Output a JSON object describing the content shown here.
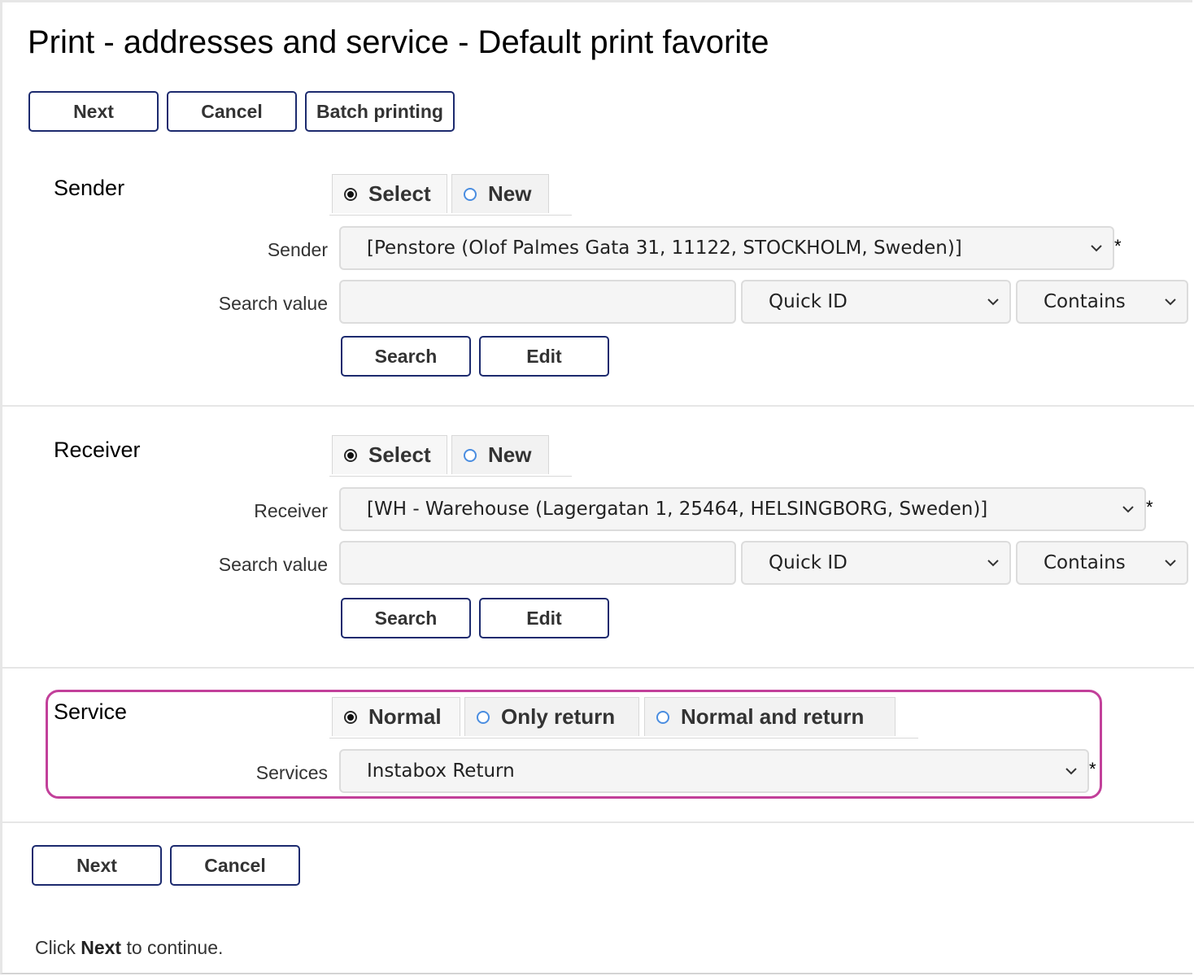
{
  "page": {
    "title": "Print - addresses and service  - Default print favorite"
  },
  "top_buttons": {
    "next": "Next",
    "cancel": "Cancel",
    "batch": "Batch printing"
  },
  "sender": {
    "section_label": "Sender",
    "tabs": [
      {
        "label": "Select",
        "checked": true
      },
      {
        "label": "New",
        "checked": false
      }
    ],
    "field_label": "Sender",
    "selected": "[Penstore (Olof Palmes Gata 31, 11122, STOCKHOLM, Sweden)]",
    "required_mark": "*",
    "search_label": "Search value",
    "search_value": "",
    "search_field": "Quick ID",
    "search_operator": "Contains",
    "search_button": "Search",
    "edit_button": "Edit"
  },
  "receiver": {
    "section_label": "Receiver",
    "tabs": [
      {
        "label": "Select",
        "checked": true
      },
      {
        "label": "New",
        "checked": false
      }
    ],
    "field_label": "Receiver",
    "selected": "[WH - Warehouse (Lagergatan 1, 25464, HELSINGBORG, Sweden)]",
    "required_mark": "*",
    "search_label": "Search value",
    "search_value": "",
    "search_field": "Quick ID",
    "search_operator": "Contains",
    "search_button": "Search",
    "edit_button": "Edit"
  },
  "service": {
    "section_label": "Service",
    "tabs": [
      {
        "label": "Normal",
        "checked": true
      },
      {
        "label": "Only return",
        "checked": false
      },
      {
        "label": "Normal and return",
        "checked": false
      }
    ],
    "field_label": "Services",
    "selected": "Instabox Return",
    "required_mark": "*",
    "highlight_color": "#c2409a"
  },
  "bottom_buttons": {
    "next": "Next",
    "cancel": "Cancel"
  },
  "footer": {
    "prefix": "Click ",
    "bold": "Next",
    "suffix": " to continue."
  },
  "colors": {
    "button_border": "#1c2a6e",
    "radio_unchecked": "#4a8de0"
  },
  "icons": {
    "dropdown": "chevron-down-icon",
    "radio_on": "radio-checked-icon",
    "radio_off": "radio-unchecked-icon"
  }
}
